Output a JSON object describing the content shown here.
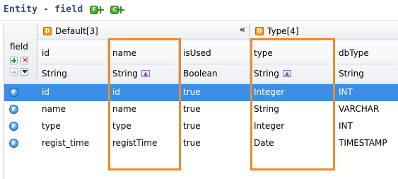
{
  "title": "Entity - field",
  "toolbar": {
    "add_field_label": "F",
    "add_column_label": "C"
  },
  "left_header": {
    "label": "field"
  },
  "groups": [
    {
      "label": "Default[3]",
      "icon": "D",
      "collapse": "«"
    },
    {
      "label": "Type[4]",
      "icon": "D"
    }
  ],
  "columns": [
    {
      "name": "id",
      "type": "String"
    },
    {
      "name": "name",
      "type": "String"
    },
    {
      "name": "isUsed",
      "type": "Boolean"
    },
    {
      "name": "type",
      "type": "String"
    },
    {
      "name": "dbType",
      "type": "String"
    }
  ],
  "rows": [
    {
      "icon": "F",
      "field": "id",
      "name": "id",
      "isUsed": "true",
      "type": "Integer",
      "dbType": "INT",
      "selected": true
    },
    {
      "icon": "F",
      "field": "name",
      "name": "name",
      "isUsed": "true",
      "type": "String",
      "dbType": "VARCHAR",
      "selected": false
    },
    {
      "icon": "F",
      "field": "type",
      "name": "type",
      "isUsed": "true",
      "type": "Integer",
      "dbType": "INT",
      "selected": false
    },
    {
      "icon": "F",
      "field": "regist_time",
      "name": "registTime",
      "isUsed": "true",
      "type": "Date",
      "dbType": "TIMESTAMP",
      "selected": false
    }
  ],
  "colors": {
    "selection": "#3d8ee6",
    "highlight_box": "#ee8a2e",
    "title_text": "#3a4d6b"
  }
}
